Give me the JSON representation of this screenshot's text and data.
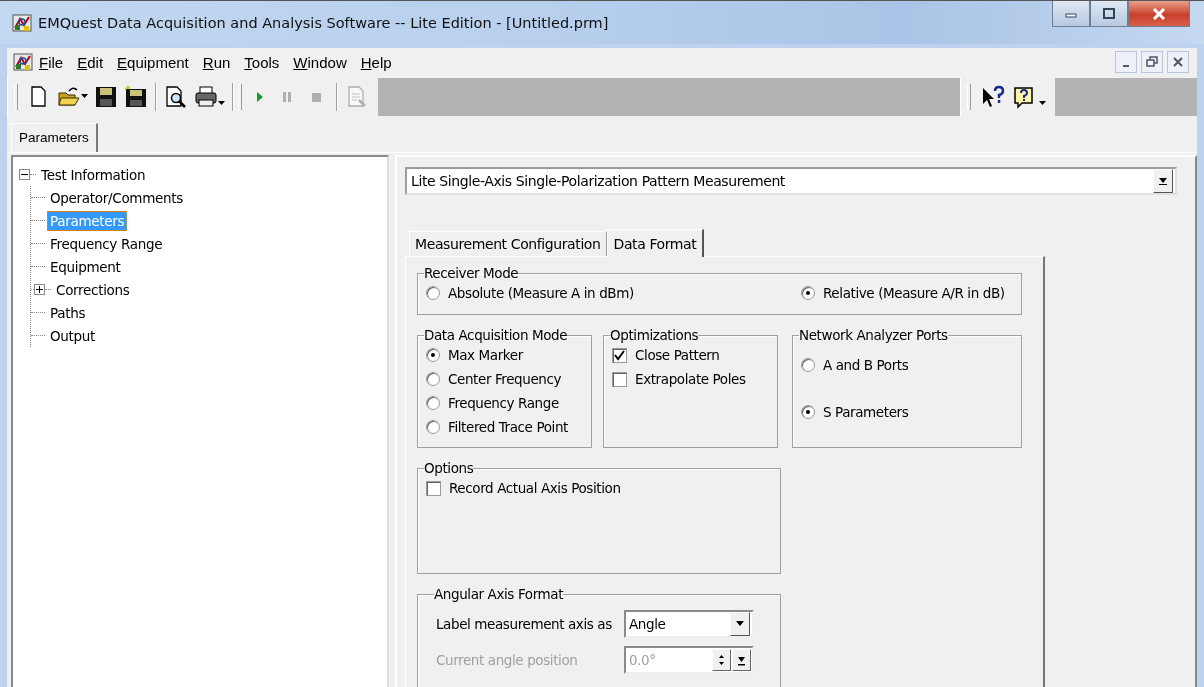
{
  "window": {
    "title": "EMQuest Data Acquisition and Analysis Software -- Lite Edition - [Untitled.prm]"
  },
  "menu": [
    {
      "label": "File",
      "first_letter_underlined": true
    },
    {
      "label": "Edit",
      "first_letter_underlined": true
    },
    {
      "label": "Equipment",
      "first_letter_underlined": true
    },
    {
      "label": "Run",
      "first_letter_underlined": true
    },
    {
      "label": "Tools",
      "first_letter_underlined": true
    },
    {
      "label": "Window",
      "first_letter_underlined": true
    },
    {
      "label": "Help",
      "first_letter_underlined": true
    }
  ],
  "toolbar": [
    {
      "kind": "new",
      "disabled": false
    },
    {
      "kind": "open",
      "disabled": false
    },
    {
      "kind": "save",
      "disabled": false
    },
    {
      "kind": "save-as",
      "disabled": false
    },
    {
      "kind": "preview",
      "disabled": false
    },
    {
      "kind": "print",
      "disabled": false
    },
    {
      "kind": "run",
      "disabled": false
    },
    {
      "kind": "pause",
      "disabled": true
    },
    {
      "kind": "stop",
      "disabled": true
    },
    {
      "kind": "report",
      "disabled": true
    }
  ],
  "doc_tabs": [
    {
      "label": "Parameters",
      "selected": true
    }
  ],
  "tree": [
    {
      "label": "Test Information",
      "expanded": true,
      "selected": false,
      "children": [
        {
          "label": "Operator/Comments",
          "selected": false
        },
        {
          "label": "Parameters",
          "selected": true
        },
        {
          "label": "Frequency Range",
          "selected": false
        },
        {
          "label": "Equipment",
          "selected": false
        },
        {
          "label": "Corrections",
          "selected": false,
          "expanded": false
        },
        {
          "label": "Paths",
          "selected": false
        },
        {
          "label": "Output",
          "selected": false
        }
      ]
    }
  ],
  "measurement_type": {
    "value": "Lite Single-Axis Single-Polarization Pattern Measurement"
  },
  "tabs": [
    {
      "label": "Measurement Configuration",
      "selected": false
    },
    {
      "label": "Data Format",
      "selected": true
    }
  ],
  "receiver_mode": {
    "title": "Receiver Mode",
    "options": [
      {
        "label": "Absolute (Measure A in dBm)",
        "selected": false
      },
      {
        "label": "Relative (Measure A/R in dB)",
        "selected": true
      }
    ]
  },
  "acquisition_mode": {
    "title": "Data Acquisition Mode",
    "options": [
      {
        "label": "Max Marker",
        "selected": true
      },
      {
        "label": "Center Frequency",
        "selected": false
      },
      {
        "label": "Frequency Range",
        "selected": false
      },
      {
        "label": "Filtered Trace Point",
        "selected": false
      }
    ]
  },
  "optimizations": {
    "title": "Optimizations",
    "options": [
      {
        "label": "Close Pattern",
        "checked": true
      },
      {
        "label": "Extrapolate Poles",
        "checked": false
      }
    ]
  },
  "analyzer_ports": {
    "title": "Network Analyzer Ports",
    "options": [
      {
        "label": "A and B Ports",
        "selected": false
      },
      {
        "label": "S Parameters",
        "selected": true
      }
    ]
  },
  "options": {
    "title": "Options",
    "options": [
      {
        "label": "Record Actual Axis Position",
        "checked": false
      }
    ]
  },
  "angular_axis_format": {
    "title": "Angular Axis Format",
    "rows": [
      {
        "kind": "combo",
        "label": "Label measurement axis as",
        "value": "Angle",
        "disabled": false
      },
      {
        "kind": "spin",
        "label": "Current angle position",
        "value": "0.0°",
        "disabled": true
      }
    ]
  }
}
